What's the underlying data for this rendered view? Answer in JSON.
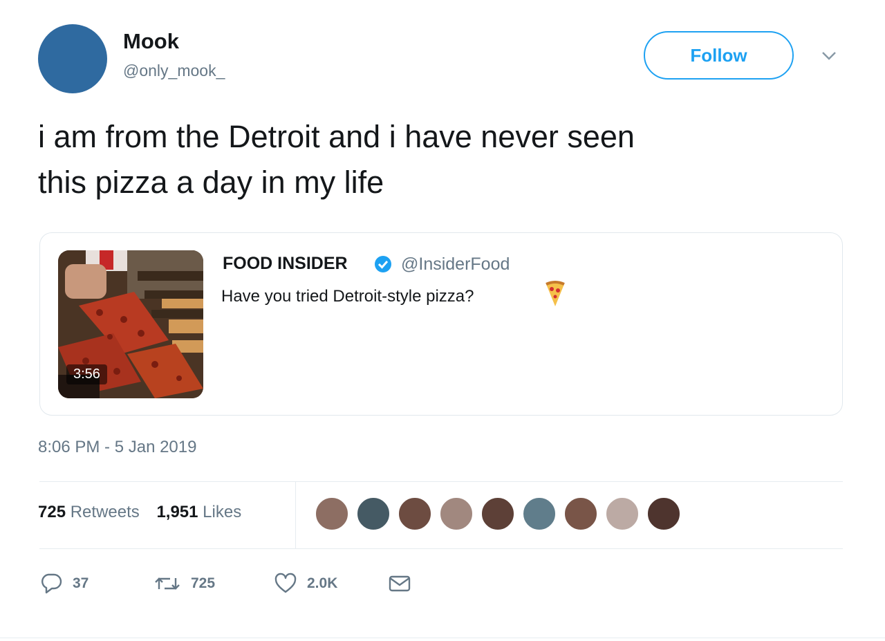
{
  "author": {
    "name": "Mook",
    "handle": "@only_mook_",
    "avatar_color": "#2f6aa0"
  },
  "follow_button": {
    "label": "Follow"
  },
  "tweet": {
    "text_line1": "i am from the Detroit and i have never seen",
    "text_line2": "this pizza a day in my life"
  },
  "quoted_tweet": {
    "name": "FOOD INSIDER",
    "handle": "@InsiderFood",
    "text": "Have you tried Detroit-style pizza?",
    "video_duration": "3:56",
    "verified_icon": "verified-badge-icon",
    "emoji_icon": "pizza-icon"
  },
  "timestamp": "8:06 PM - 5 Jan 2019",
  "stats": {
    "retweets_count": "725",
    "retweets_label": "Retweets",
    "likes_count": "1,951",
    "likes_label": "Likes"
  },
  "likers_count": 9,
  "actions": {
    "reply_count": "37",
    "retweet_count": "725",
    "like_count": "2.0K"
  },
  "colors": {
    "accent": "#1da1f2",
    "secondary_text": "#657786",
    "border": "#e1e8ed"
  }
}
